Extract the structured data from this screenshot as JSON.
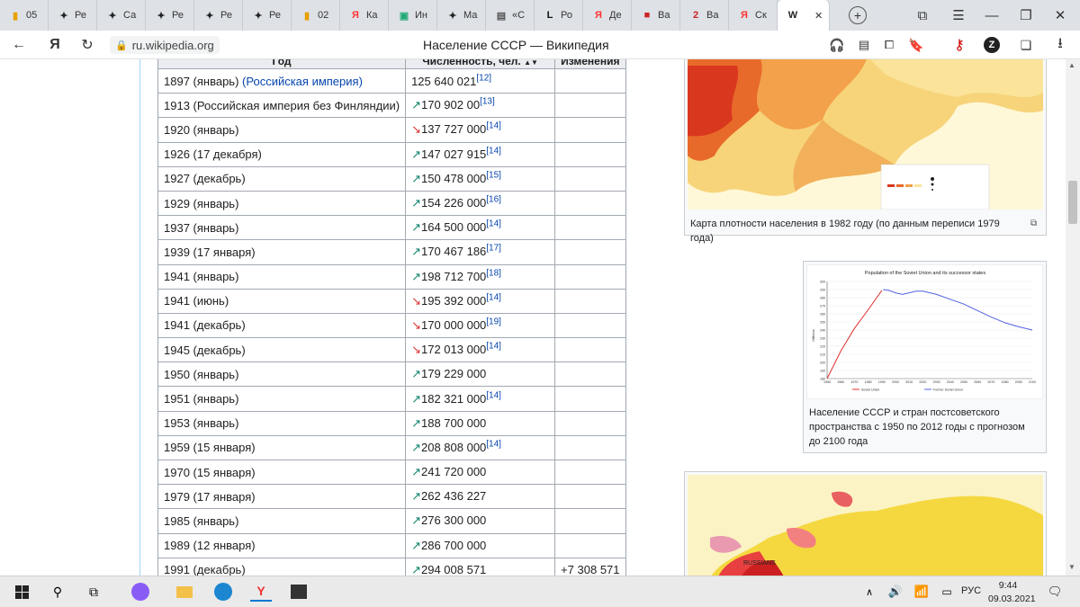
{
  "tabs": [
    {
      "label": "05",
      "icon": "bars-chart-icon",
      "color": "#e8a000"
    },
    {
      "label": "Ре",
      "icon": "sparkle-icon",
      "color": "#222"
    },
    {
      "label": "Са",
      "icon": "sparkle-icon",
      "color": "#222"
    },
    {
      "label": "Ре",
      "icon": "sparkle-icon",
      "color": "#222"
    },
    {
      "label": "Ре",
      "icon": "sparkle-icon",
      "color": "#222"
    },
    {
      "label": "Ре",
      "icon": "sparkle-icon",
      "color": "#222"
    },
    {
      "label": "02",
      "icon": "bars-chart-icon",
      "color": "#e8a000"
    },
    {
      "label": "Ка",
      "icon": "yandex-icon",
      "color": "#f33"
    },
    {
      "label": "Ин",
      "icon": "image-icon",
      "color": "#2a7"
    },
    {
      "label": "Ма",
      "icon": "sparkle-icon",
      "color": "#222"
    },
    {
      "label": "«С",
      "icon": "list-icon",
      "color": "#555"
    },
    {
      "label": "Ро",
      "icon": "l-icon",
      "color": "#111"
    },
    {
      "label": "Де",
      "icon": "yandex-icon",
      "color": "#f33"
    },
    {
      "label": "Ва",
      "icon": "badge-icon",
      "color": "#c22"
    },
    {
      "label": "Ва",
      "icon": "two-icon",
      "color": "#c22"
    },
    {
      "label": "Ск",
      "icon": "yandex-icon",
      "color": "#f33"
    },
    {
      "label": "W",
      "icon": "wikipedia-icon",
      "color": "#222"
    }
  ],
  "address": {
    "url": "ru.wikipedia.org",
    "title": "Население СССР — Википедия"
  },
  "table": {
    "headers": [
      "Год",
      "Численность, чел.",
      "Изменения"
    ],
    "rows": [
      {
        "year": "1897 (январь)",
        "link": "(Российская империя)",
        "arrow": "",
        "value": "125 640 021",
        "ref": "[12]",
        "change": ""
      },
      {
        "year": "1913 (Российская империя без Финляндии)",
        "link": "",
        "arrow": "↗",
        "value": "170 902 00",
        "ref": "[13]",
        "change": ""
      },
      {
        "year": "1920 (январь)",
        "link": "",
        "arrow": "↘",
        "value": "137 727 000",
        "ref": "[14]",
        "change": ""
      },
      {
        "year": "1926 (17 декабря)",
        "link": "",
        "arrow": "↗",
        "value": "147 027 915",
        "ref": "[14]",
        "change": ""
      },
      {
        "year": "1927 (декабрь)",
        "link": "",
        "arrow": "↗",
        "value": "150 478 000",
        "ref": "[15]",
        "change": ""
      },
      {
        "year": "1929 (январь)",
        "link": "",
        "arrow": "↗",
        "value": "154 226 000",
        "ref": "[16]",
        "change": ""
      },
      {
        "year": "1937 (январь)",
        "link": "",
        "arrow": "↗",
        "value": "164 500 000",
        "ref": "[14]",
        "change": ""
      },
      {
        "year": "1939 (17 января)",
        "link": "",
        "arrow": "↗",
        "value": "170 467 186",
        "ref": "[17]",
        "change": ""
      },
      {
        "year": "1941 (январь)",
        "link": "",
        "arrow": "↗",
        "value": "198 712 700",
        "ref": "[18]",
        "change": ""
      },
      {
        "year": "1941 (июнь)",
        "link": "",
        "arrow": "↘",
        "value": "195 392 000",
        "ref": "[14]",
        "change": ""
      },
      {
        "year": "1941 (декабрь)",
        "link": "",
        "arrow": "↘",
        "value": "170 000 000",
        "ref": "[19]",
        "change": ""
      },
      {
        "year": "1945 (декабрь)",
        "link": "",
        "arrow": "↘",
        "value": "172 013 000",
        "ref": "[14]",
        "change": ""
      },
      {
        "year": "1950 (январь)",
        "link": "",
        "arrow": "↗",
        "value": "179 229 000",
        "ref": "",
        "change": ""
      },
      {
        "year": "1951 (январь)",
        "link": "",
        "arrow": "↗",
        "value": "182 321 000",
        "ref": "[14]",
        "change": ""
      },
      {
        "year": "1953 (январь)",
        "link": "",
        "arrow": "↗",
        "value": "188 700 000",
        "ref": "",
        "change": ""
      },
      {
        "year": "1959 (15 января)",
        "link": "",
        "arrow": "↗",
        "value": "208 808 000",
        "ref": "[14]",
        "change": ""
      },
      {
        "year": "1970 (15 января)",
        "link": "",
        "arrow": "↗",
        "value": "241 720 000",
        "ref": "",
        "change": ""
      },
      {
        "year": "1979 (17 января)",
        "link": "",
        "arrow": "↗",
        "value": "262 436 227",
        "ref": "",
        "change": ""
      },
      {
        "year": "1985 (январь)",
        "link": "",
        "arrow": "↗",
        "value": "276 300 000",
        "ref": "",
        "change": ""
      },
      {
        "year": "1989 (12 января)",
        "link": "",
        "arrow": "↗",
        "value": "286 700 000",
        "ref": "",
        "change": ""
      },
      {
        "year": "1991 (декабрь)",
        "link": "",
        "arrow": "↗",
        "value": "294 008 571",
        "ref": "",
        "change": "+7 308 571"
      }
    ]
  },
  "map1": {
    "caption": "Карта плотности населения в 1982 году (по данным переписи 1979 года)"
  },
  "chart_thumb": {
    "caption": "Население СССР и стран постсоветского пространства с 1950 по 2012 годы с прогнозом до 2100 года",
    "title": "Population of the Soviet Union and its successor states",
    "ylabel": "Millions"
  },
  "chart_data": {
    "type": "line",
    "title": "Population of the Soviet Union and its successor states",
    "ylabel": "Millions",
    "xlim": [
      1950,
      2100
    ],
    "ylim": [
      180,
      300
    ],
    "x_ticks": [
      "1950",
      "1960",
      "1970",
      "1980",
      "1990",
      "2000",
      "2010",
      "2020",
      "2030",
      "2040",
      "2050",
      "2060",
      "2070",
      "2080",
      "2090",
      "2100"
    ],
    "y_ticks": [
      "300",
      "290",
      "280",
      "270",
      "260",
      "250",
      "240",
      "230",
      "220",
      "210",
      "200",
      "190",
      "180"
    ],
    "series": [
      {
        "name": "Soviet Union",
        "color": "#e03030",
        "x": [
          1950,
          1960,
          1970,
          1980,
          1990
        ],
        "y": [
          180,
          214,
          242,
          265,
          289
        ]
      },
      {
        "name": "Former Soviet Union",
        "color": "#5060e0",
        "x": [
          1991,
          1995,
          2000,
          2005,
          2010,
          2015,
          2020,
          2030,
          2040,
          2050,
          2060,
          2070,
          2080,
          2090,
          2100
        ],
        "y": [
          290,
          289,
          286,
          284,
          286,
          288,
          288,
          284,
          278,
          272,
          264,
          256,
          249,
          244,
          240
        ]
      }
    ]
  },
  "taskbar": {
    "lang": "РУС",
    "time": "9:44",
    "date": "09.03.2021"
  }
}
